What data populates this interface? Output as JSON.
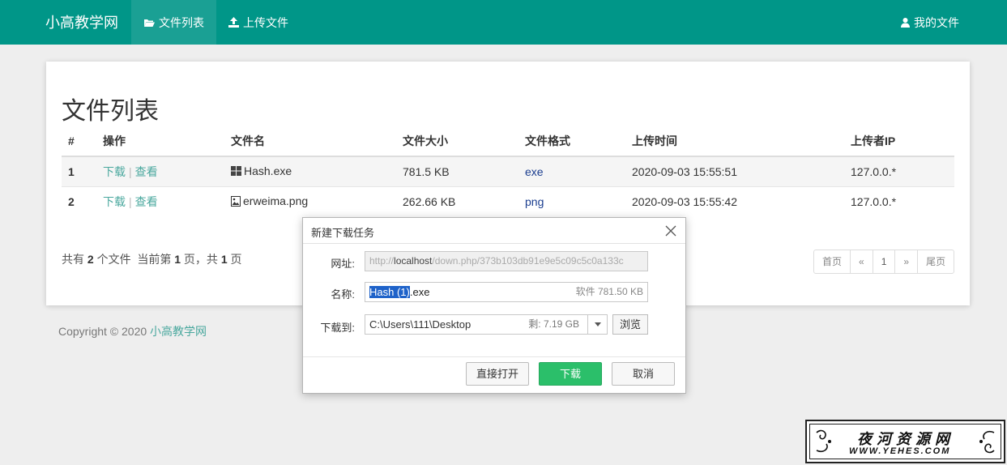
{
  "navbar": {
    "brand": "小高教学网",
    "items": [
      {
        "label": "文件列表",
        "icon": "folder-open-icon",
        "active": true
      },
      {
        "label": "上传文件",
        "icon": "upload-icon",
        "active": false
      }
    ],
    "right": {
      "label": "我的文件",
      "icon": "user-icon"
    }
  },
  "card": {
    "title": "文件列表",
    "columns": [
      "#",
      "操作",
      "文件名",
      "文件大小",
      "文件格式",
      "上传时间",
      "上传者IP"
    ],
    "rows": [
      {
        "num": "1",
        "download": "下载",
        "sep": "|",
        "view": "查看",
        "file_icon": "windows-icon",
        "name": "Hash.exe",
        "size": "781.5 KB",
        "format": "exe",
        "time": "2020-09-03 15:55:51",
        "ip": "127.0.0.*"
      },
      {
        "num": "2",
        "download": "下载",
        "sep": "|",
        "view": "查看",
        "file_icon": "image-file-icon",
        "name": "erweima.png",
        "size": "262.66 KB",
        "format": "png",
        "time": "2020-09-03 15:55:42",
        "ip": "127.0.0.*"
      }
    ],
    "summary": {
      "pre": "共有 ",
      "count": "2",
      "mid1": " 个文件  当前第 ",
      "page": "1",
      "mid2": " 页，共 ",
      "total": "1",
      "post": " 页"
    },
    "pager": {
      "first": "首页",
      "prev": "«",
      "current": "1",
      "next": "»",
      "last": "尾页"
    }
  },
  "footer": {
    "text": "Copyright © 2020 ",
    "link": "小高教学网"
  },
  "dialog": {
    "title": "新建下载任务",
    "url_label": "网址:",
    "url_scheme": "http://",
    "url_host": "localhost",
    "url_path": "/down.php/373b103db91e9e5c09c5c0a133c",
    "name_label": "名称:",
    "name_selected": "Hash (1)",
    "name_ext": ".exe",
    "name_info": "软件 781.50 KB",
    "path_label": "下载到:",
    "path_value": "C:\\Users\\111\\Desktop",
    "path_free": "剩: 7.19 GB",
    "browse": "浏览",
    "open_button": "直接打开",
    "download_button": "下载",
    "cancel_button": "取消"
  },
  "watermark": {
    "cn": "夜河资源网",
    "en": "WWW.YEHES.COM"
  },
  "colors": {
    "primary": "#009688",
    "active_nav": "#1aa094",
    "link": "#4aa89e",
    "download_green": "#2bbf6a"
  }
}
